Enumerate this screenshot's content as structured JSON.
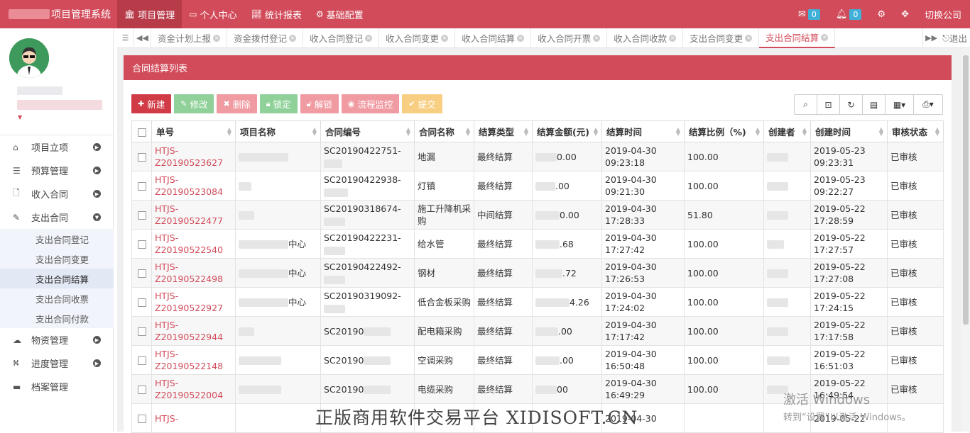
{
  "app": {
    "title": "项目管理系统"
  },
  "topnav": [
    {
      "label": "项目管理",
      "icon": "bank-icon",
      "active": true
    },
    {
      "label": "个人中心",
      "icon": "card-icon",
      "active": false
    },
    {
      "label": "统计报表",
      "icon": "chart-icon",
      "active": false
    },
    {
      "label": "基础配置",
      "icon": "gear-icon",
      "active": false
    }
  ],
  "topright": {
    "mail_count": "0",
    "bell_count": "0",
    "switch_company": "切换公司"
  },
  "sidebar": {
    "menu": [
      {
        "label": "项目立项",
        "icon": "home-icon"
      },
      {
        "label": "预算管理",
        "icon": "list-icon"
      },
      {
        "label": "收入合同",
        "icon": "file-icon"
      },
      {
        "label": "支出合同",
        "icon": "edit-icon",
        "expanded": true
      }
    ],
    "submenu": [
      {
        "label": "支出合同登记"
      },
      {
        "label": "支出合同变更"
      },
      {
        "label": "支出合同结算",
        "active": true
      },
      {
        "label": "支出合同收票"
      },
      {
        "label": "支出合同付款"
      }
    ],
    "menu2": [
      {
        "label": "物资管理",
        "icon": "cloud-icon"
      },
      {
        "label": "进度管理",
        "icon": "road-icon"
      },
      {
        "label": "档案管理",
        "icon": "folder-icon"
      }
    ]
  },
  "tabs": [
    "资金计划上报",
    "资金拨付登记",
    "收入合同登记",
    "收入合同变更",
    "收入合同结算",
    "收入合同开票",
    "收入合同收款",
    "支出合同变更",
    "支出合同结算"
  ],
  "tabs_logout": "退出",
  "panel": {
    "title": "合同结算列表"
  },
  "toolbar": {
    "new": "新建",
    "edit": "修改",
    "delete": "删除",
    "lock": "锁定",
    "unlock": "解锁",
    "flow": "流程监控",
    "submit": "提交"
  },
  "table": {
    "headers": [
      "单号",
      "项目名称",
      "合同编号",
      "合同名称",
      "结算类型",
      "结算金额(元)",
      "结算时间",
      "结算比例（%)",
      "创建者",
      "创建时间",
      "审核状态"
    ],
    "rows": [
      {
        "id1": "HTJS-",
        "id2": "Z20190523627",
        "proj": "",
        "code1": "SC20190422751-",
        "code2": "",
        "name": "地漏",
        "type": "最终结算",
        "amt": "0.00",
        "t1": "2019-04-30",
        "t2": "09:23:18",
        "ratio": "100.00",
        "c1": "2019-05-23",
        "c2": "09:23:31",
        "status": "已审核"
      },
      {
        "id1": "HTJS-",
        "id2": "Z20190523084",
        "proj": "",
        "code1": "SC20190422938-",
        "code2": "",
        "name": "灯镇",
        "type": "最终结算",
        "amt": ".00",
        "t1": "2019-04-30",
        "t2": "09:21:30",
        "ratio": "100.00",
        "c1": "2019-05-23",
        "c2": "09:22:27",
        "status": "已审核"
      },
      {
        "id1": "HTJS-",
        "id2": "Z20190522477",
        "proj": "",
        "code1": "SC20190318674-",
        "code2": "",
        "name": "施工升降机采购",
        "type": "中间结算",
        "amt": "0.00",
        "t1": "2019-04-30",
        "t2": "17:28:33",
        "ratio": "51.80",
        "c1": "2019-05-22",
        "c2": "17:28:59",
        "status": "已审核"
      },
      {
        "id1": "HTJS-",
        "id2": "Z20190522540",
        "proj": "中心",
        "code1": "SC20190422231-",
        "code2": "",
        "name": "给水管",
        "type": "最终结算",
        "amt": ".68",
        "t1": "2019-04-30",
        "t2": "17:27:42",
        "ratio": "100.00",
        "c1": "2019-05-22",
        "c2": "17:27:57",
        "status": "已审核"
      },
      {
        "id1": "HTJS-",
        "id2": "Z20190522498",
        "proj": "中心",
        "code1": "SC20190422492-",
        "code2": "",
        "name": "钢材",
        "type": "最终结算",
        "amt": ".72",
        "t1": "2019-04-30",
        "t2": "17:26:53",
        "ratio": "100.00",
        "c1": "2019-05-22",
        "c2": "17:27:08",
        "status": "已审核"
      },
      {
        "id1": "HTJS-",
        "id2": "Z20190522927",
        "proj": "中心",
        "code1": "SC20190319092-",
        "code2": "",
        "name": "低合金板采购",
        "type": "最终结算",
        "amt": "4.26",
        "t1": "2019-04-30",
        "t2": "17:24:02",
        "ratio": "100.00",
        "c1": "2019-05-22",
        "c2": "17:24:15",
        "status": "已审核"
      },
      {
        "id1": "HTJS-",
        "id2": "Z20190522944",
        "proj": "",
        "code1": "SC20190",
        "code2": "",
        "name": "配电箱采购",
        "type": "最终结算",
        "amt": ".00",
        "t1": "2019-04-30",
        "t2": "17:17:42",
        "ratio": "100.00",
        "c1": "2019-05-22",
        "c2": "17:17:58",
        "status": "已审核"
      },
      {
        "id1": "HTJS-",
        "id2": "Z20190522148",
        "proj": "",
        "code1": "SC20190",
        "code2": "",
        "name": "空调采购",
        "type": "最终结算",
        "amt": ".00",
        "t1": "2019-04-30",
        "t2": "16:50:48",
        "ratio": "100.00",
        "c1": "2019-05-22",
        "c2": "16:51:03",
        "status": "已审核"
      },
      {
        "id1": "HTJS-",
        "id2": "Z20190522004",
        "proj": "",
        "code1": "SC20190",
        "code2": "",
        "name": "电缆采购",
        "type": "最终结算",
        "amt": "00",
        "t1": "2019-04-30",
        "t2": "16:49:29",
        "ratio": "100.00",
        "c1": "2019-05-22",
        "c2": "16:49:54",
        "status": "已审核"
      },
      {
        "id1": "HTJS-",
        "id2": "",
        "proj": "",
        "code1": "",
        "code2": "",
        "name": "",
        "type": "",
        "amt": "",
        "t1": "2019-04-30",
        "t2": "",
        "ratio": "",
        "c1": "2019-05-22",
        "c2": "",
        "status": ""
      }
    ]
  },
  "watermark": "正版商用软件交易平台 XIDISOFT.CN",
  "windows": {
    "line1": "激活 Windows",
    "line2": "转到“设置”以激活 Windows。"
  }
}
